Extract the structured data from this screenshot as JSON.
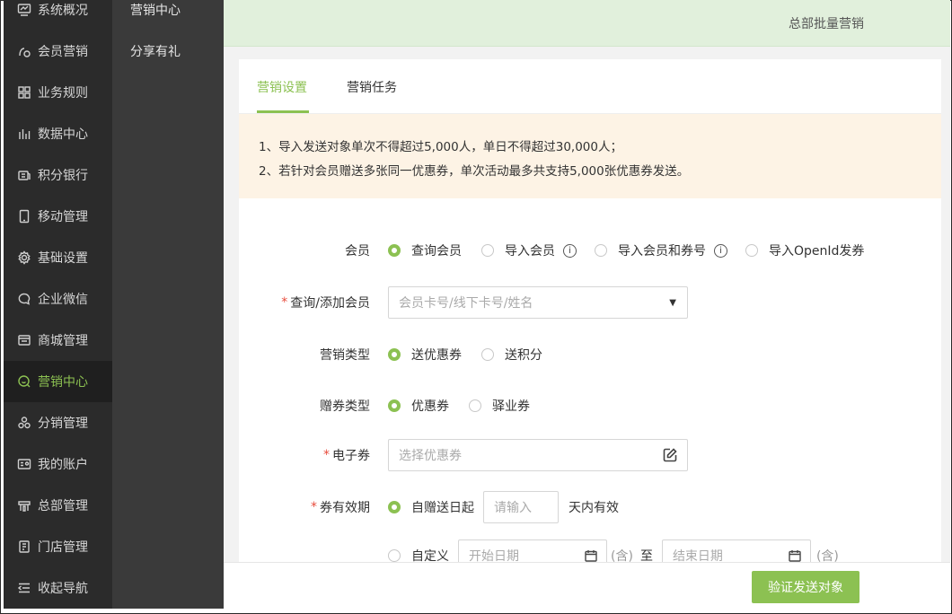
{
  "sidebar": {
    "items": [
      {
        "label": "系统概况",
        "icon": "monitor-icon"
      },
      {
        "label": "会员营销",
        "icon": "member-icon"
      },
      {
        "label": "业务规则",
        "icon": "grid-icon"
      },
      {
        "label": "数据中心",
        "icon": "bar-chart-icon"
      },
      {
        "label": "积分银行",
        "icon": "bank-icon"
      },
      {
        "label": "移动管理",
        "icon": "mobile-icon"
      },
      {
        "label": "基础设置",
        "icon": "gear-icon"
      },
      {
        "label": "企业微信",
        "icon": "chat-icon"
      },
      {
        "label": "商城管理",
        "icon": "store-icon"
      },
      {
        "label": "营销中心",
        "icon": "marketing-icon",
        "active": true
      },
      {
        "label": "分销管理",
        "icon": "distribution-icon"
      },
      {
        "label": "我的账户",
        "icon": "account-icon"
      },
      {
        "label": "总部管理",
        "icon": "headquarters-icon"
      },
      {
        "label": "门店管理",
        "icon": "shop-icon"
      },
      {
        "label": "收起导航",
        "icon": "collapse-icon"
      }
    ]
  },
  "subnav": {
    "items": [
      {
        "label": "营销中心"
      },
      {
        "label": "分享有礼"
      }
    ]
  },
  "topbar": {
    "title": "总部批量营销"
  },
  "tabs": [
    {
      "label": "营销设置",
      "active": true
    },
    {
      "label": "营销任务"
    }
  ],
  "notice": {
    "lines": [
      "1、导入发送对象单次不得超过5,000人，单日不得超过30,000人；",
      "2、若针对会员赠送多张同一优惠券，单次活动最多共支持5,000张优惠券发送。"
    ]
  },
  "form": {
    "member": {
      "label": "会员",
      "options": [
        "查询会员",
        "导入会员",
        "导入会员和券号",
        "导入OpenId发券"
      ],
      "selected": "查询会员"
    },
    "query_member": {
      "label": "查询/添加会员",
      "placeholder": "会员卡号/线下卡号/姓名"
    },
    "marketing_type": {
      "label": "营销类型",
      "options": [
        "送优惠券",
        "送积分"
      ],
      "selected": "送优惠券"
    },
    "coupon_type": {
      "label": "赠券类型",
      "options": [
        "优惠券",
        "驿业券"
      ],
      "selected": "优惠券"
    },
    "e_coupon": {
      "label": "电子券",
      "placeholder": "选择优惠券"
    },
    "validity": {
      "label": "券有效期",
      "option1": "自赠送日起",
      "days_placeholder": "请输入",
      "days_suffix": "天内有效",
      "option2": "自定义",
      "start_placeholder": "开始日期",
      "end_placeholder": "结束日期",
      "inclusive": "(含)",
      "to": "至"
    }
  },
  "footer": {
    "verify_button": "验证发送对象"
  },
  "colors": {
    "accent": "#8cc152",
    "sidebar_bg": "#2b2b2b",
    "notice_bg": "#fdf3e5",
    "required": "#e84c3d"
  }
}
